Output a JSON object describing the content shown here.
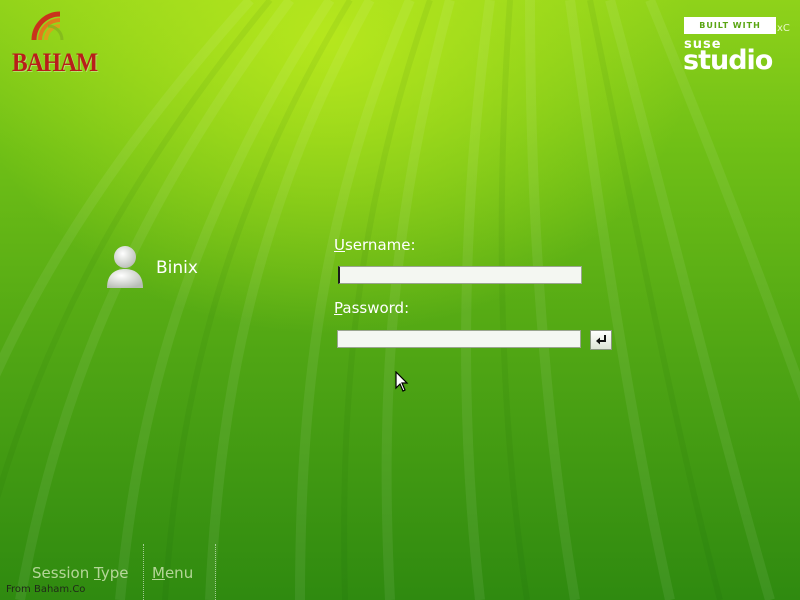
{
  "branding": {
    "logo_text": "BAHAM",
    "built_with": "BUILT WITH",
    "xc": "xC",
    "suse": "suse",
    "studio": "studio"
  },
  "user": {
    "name": "Binix",
    "icon": "user-avatar-icon"
  },
  "login": {
    "username_label_accel": "U",
    "username_label_rest": "sername:",
    "username_value": "",
    "password_label_accel": "P",
    "password_label_rest": "assword:",
    "password_value": "",
    "submit_icon": "enter-arrow-icon"
  },
  "bottom_menu": {
    "session_type_prefix": "Session ",
    "session_type_accel": "T",
    "session_type_suffix": "ype",
    "menu_accel": "M",
    "menu_rest": "enu"
  },
  "footer": {
    "text": "From Baham.Co"
  },
  "colors": {
    "background_light": "#8fd21a",
    "background_dark": "#2f8a10",
    "logo_red": "#b81e1a"
  }
}
